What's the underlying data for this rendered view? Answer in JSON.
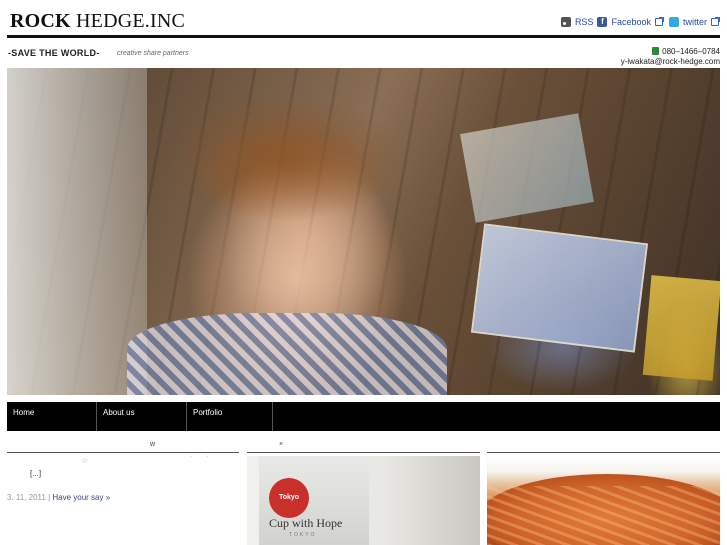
{
  "site": {
    "logo_bold": "ROCK",
    "logo_rest": " HEDGE.INC",
    "tagline": "-SAVE THE WORLD-",
    "subtagline": "creative share partners"
  },
  "social": {
    "rss_label": "RSS",
    "facebook_label": "Facebook",
    "twitter_label": "twitter"
  },
  "contact": {
    "phone": "080–1466–0784",
    "email": "y-iwakata@rock-hedge.com"
  },
  "nav": {
    "items": [
      {
        "label": "Home"
      },
      {
        "label": "About us"
      },
      {
        "label": "Portfolio"
      }
    ]
  },
  "left_column": {
    "heading": "w",
    "star": "☆",
    "dots": "· ·",
    "excerpt": "[...]",
    "date": "3. 11, 2011 | ",
    "comment_link": "Have your say »"
  },
  "middle_column": {
    "heading": "×",
    "thumb_badge": "Tokyo",
    "thumb_text": "Cup with Hope",
    "thumb_subtext": "TOKYO"
  },
  "colors": {
    "nav_background": "#000000",
    "link_blue": "#2a4a9a",
    "rule": "#111111"
  },
  "icons": [
    "rss-icon",
    "facebook-icon",
    "twitter-icon",
    "external-link-icon",
    "phone-icon"
  ]
}
